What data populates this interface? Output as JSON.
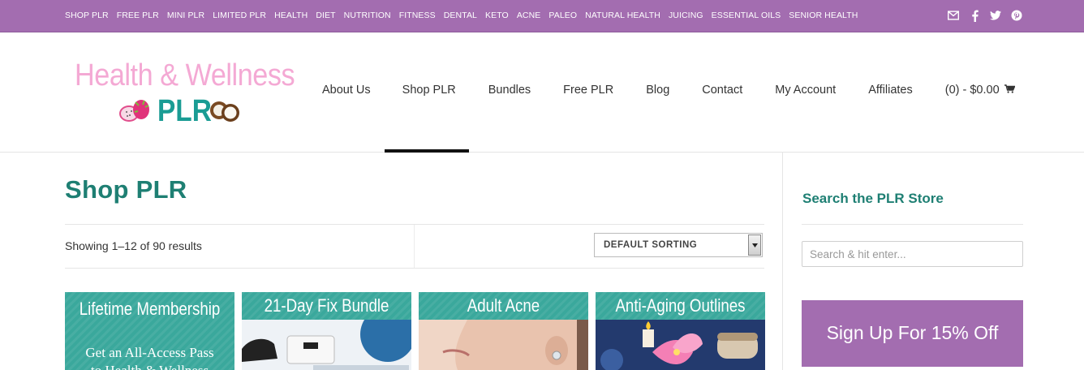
{
  "topbar": {
    "links": [
      "SHOP PLR",
      "FREE PLR",
      "MINI PLR",
      "LIMITED PLR",
      "HEALTH",
      "DIET",
      "NUTRITION",
      "FITNESS",
      "DENTAL",
      "KETO",
      "ACNE",
      "PALEO",
      "NATURAL HEALTH",
      "JUICING",
      "ESSENTIAL OILS",
      "SENIOR HEALTH"
    ],
    "social_icons": [
      "email-icon",
      "facebook-icon",
      "twitter-icon",
      "pinterest-icon"
    ]
  },
  "logo": {
    "line1": "Health & Wellness",
    "line2": "PLR"
  },
  "nav": {
    "items": [
      "About Us",
      "Shop PLR",
      "Bundles",
      "Free PLR",
      "Blog",
      "Contact",
      "My Account",
      "Affiliates"
    ],
    "cart": "(0) - $0.00",
    "active": "Shop PLR"
  },
  "main": {
    "title": "Shop PLR",
    "result_count": "Showing 1–12 of 90 results",
    "sort_selected": "DEFAULT SORTING"
  },
  "products": [
    {
      "title": "Lifetime Membership",
      "subtitle": "Get an All-Access Pass",
      "subtitle2": "to Health & Wellness"
    },
    {
      "title": "21-Day Fix Bundle"
    },
    {
      "title": "Adult Acne"
    },
    {
      "title": "Anti-Aging Outlines"
    }
  ],
  "sidebar": {
    "search_title": "Search the PLR Store",
    "search_placeholder": "Search & hit enter...",
    "signup_label": "Sign Up For 15% Off"
  },
  "colors": {
    "topbar": "#a36db0",
    "teal": "#1e7f73",
    "product_teal": "#3aa89c",
    "logo_pink": "#f4a9d4",
    "logo_teal": "#1a9c94"
  }
}
